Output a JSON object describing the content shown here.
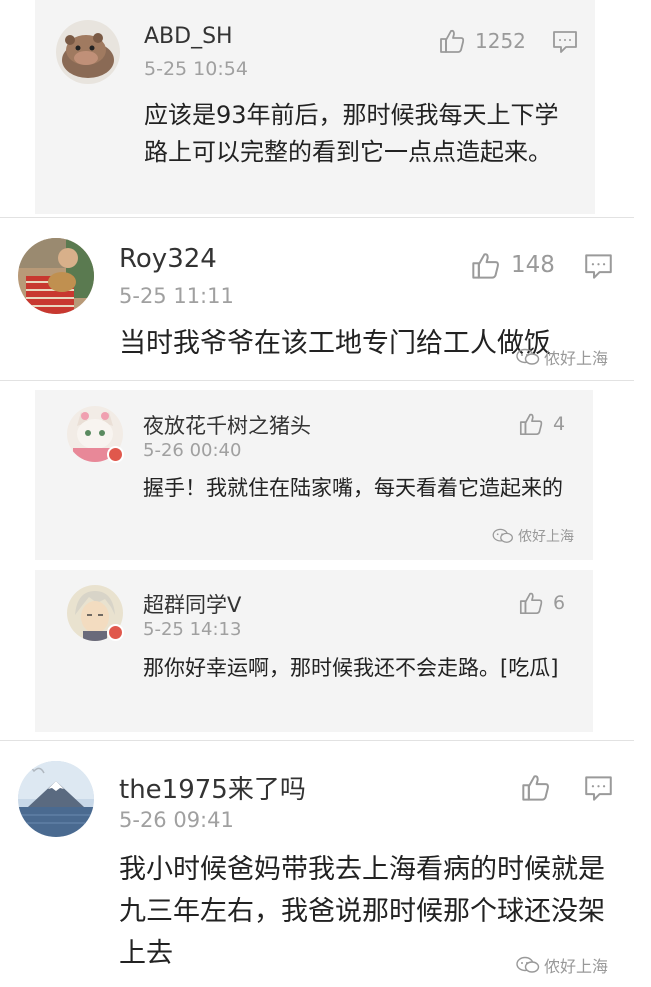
{
  "comments": [
    {
      "username": "ABD_SH",
      "time": "5-25 10:54",
      "likes": "1252",
      "text": "应该是93年前后，那时候我每天上下学路上可以完整的看到它一点点造起来。",
      "avatar": "hippo-avatar-icon"
    },
    {
      "username": "Roy324",
      "time": "5-25 11:11",
      "likes": "148",
      "text": "当时我爷爷在该工地专门给工人做饭",
      "avatar": "guitar-player-avatar-icon",
      "watermark": "侬好上海"
    },
    {
      "username": "夜放花千树之猪头",
      "time": "5-26 00:40",
      "likes": "4",
      "text": "握手！我就住在陆家嘴，每天看着它造起来的",
      "avatar": "cat-avatar-icon",
      "watermark": "侬好上海"
    },
    {
      "username": "超群同学V",
      "time": "5-25 14:13",
      "likes": "6",
      "text": "那你好幸运啊，那时候我还不会走路。[吃瓜]",
      "avatar": "anime-boy-avatar-icon"
    },
    {
      "username": "the1975来了吗",
      "time": "5-26 09:41",
      "likes": "",
      "text": "我小时候爸妈带我去上海看病的时候就是九三年左右，我爸说那时候那个球还没架上去",
      "avatar": "mountain-lake-avatar-icon",
      "watermark": "侬好上海"
    }
  ],
  "colors": {
    "card_gray": "#f4f4f4",
    "badge_red": "#e0584c",
    "icon_gray": "#9a9a9a"
  }
}
